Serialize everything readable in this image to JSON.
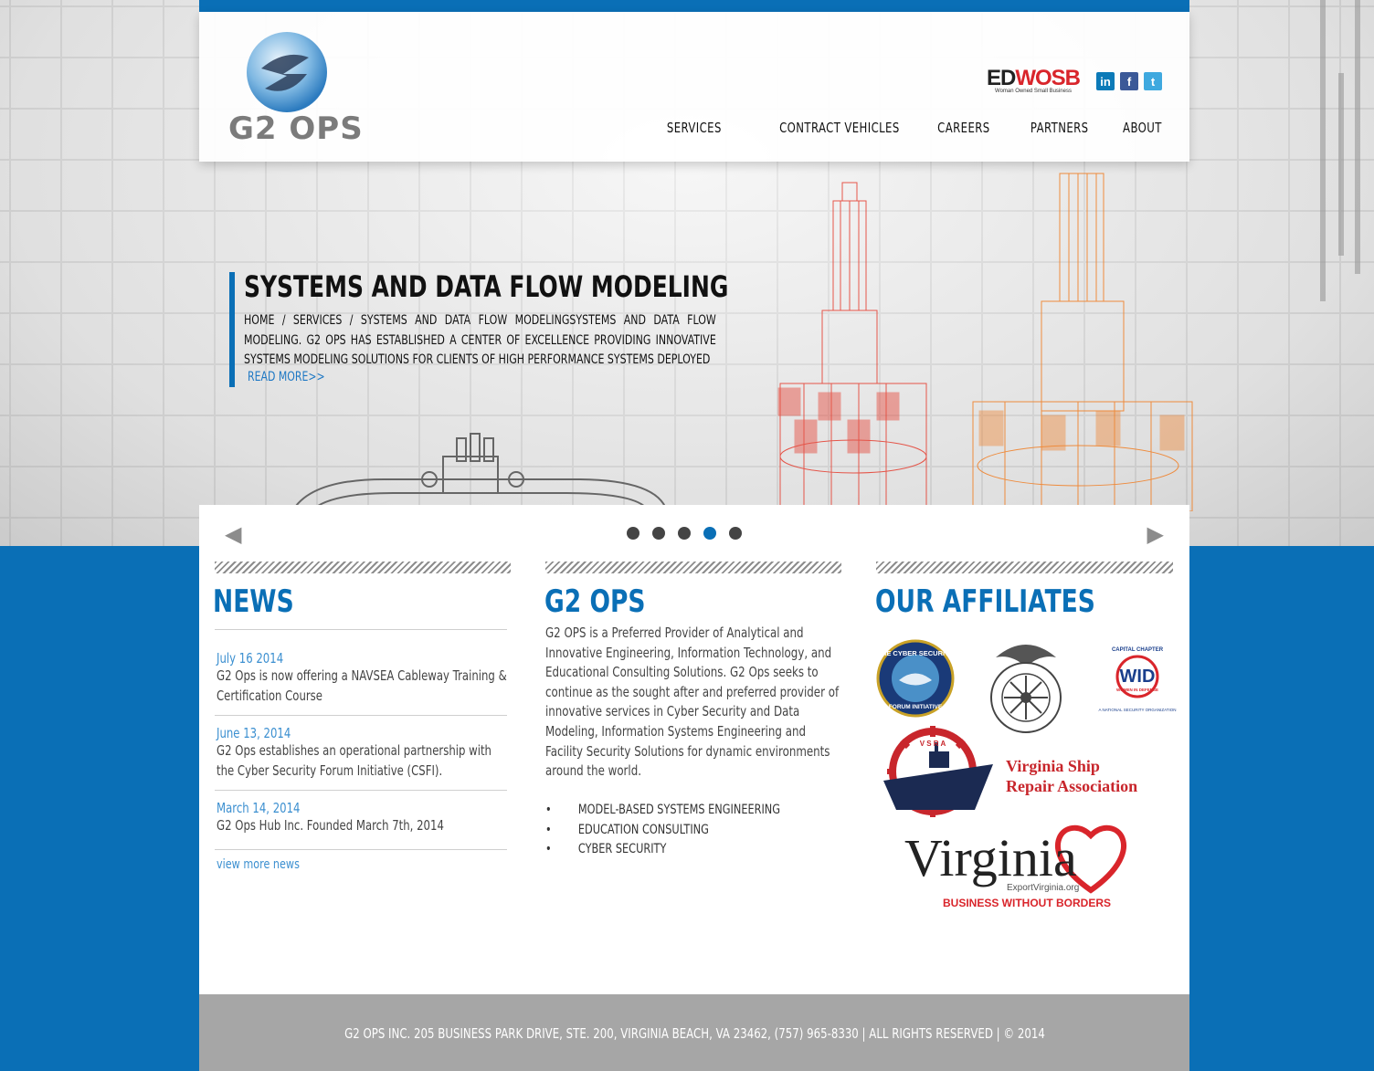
{
  "header": {
    "logo_text": "G2 OPS",
    "badge": {
      "ed": "ED",
      "wosb": "WOSB",
      "sub": "Woman Owned Small Business"
    },
    "social": [
      {
        "name": "linkedin",
        "glyph": "in"
      },
      {
        "name": "facebook",
        "glyph": "f"
      },
      {
        "name": "twitter",
        "glyph": "t"
      }
    ],
    "nav": [
      "SERVICES",
      "CONTRACT VEHICLES",
      "CAREERS",
      "PARTNERS",
      "ABOUT"
    ]
  },
  "hero": {
    "title": "SYSTEMS AND DATA FLOW MODELING",
    "body": "Home / Services / Systems and Data Flow ModelingSystems and Data Flow Modeling. G2 Ops has established a Center of Excellence providing innovative systems modeling solutions for clients of high performance systems deployed",
    "read_more": "Read More>>"
  },
  "slider": {
    "dots": 5,
    "active_index": 3
  },
  "news": {
    "title": "NEWS",
    "items": [
      {
        "date": "July 16 2014",
        "text": "G2 Ops is now offering a NAVSEA Cableway Training & Certification Course"
      },
      {
        "date": "June 13, 2014",
        "text": "G2 Ops establishes an operational partnership with the Cyber Security Forum Initiative (CSFI)."
      },
      {
        "date": "March 14, 2014",
        "text": "G2 Ops Hub Inc. Founded March 7th, 2014"
      }
    ],
    "more_link": "view more news"
  },
  "about": {
    "title": "G2 OPS",
    "text": "G2 OPS is a Preferred Provider of Analytical and Innovative Engineering, Information Technology, and Educational Consulting Solutions. G2 Ops seeks to continue as the sought after and preferred provider of innovative services in Cyber Security and Data Modeling, Information Systems Engineering and Facility Security Solutions for dynamic environments around the world.",
    "bullets": [
      "MODEL-BASED SYSTEMS ENGINEERING",
      "EDUCATION CONSULTING",
      "CYBER SECURITY"
    ]
  },
  "affiliates": {
    "title": "OUR AFFILIATES",
    "csfi": {
      "top": "THE CYBER SECURITY",
      "bottom": "FORUM INITIATIVE"
    },
    "wid": {
      "top": "CAPITAL CHAPTER",
      "letters": "WID",
      "mid": "WOMEN IN DEFENSE",
      "bottom": "A NATIONAL SECURITY ORGANIZATION"
    },
    "vsra": {
      "wheel": "V S R A",
      "line1": "Virginia Ship",
      "line2": "Repair Association"
    },
    "virginia": {
      "word": "Virginia",
      "url": "ExportVirginia.org",
      "tag": "BUSINESS WITHOUT BORDERS"
    }
  },
  "footer": {
    "text": "G2 OPS INC. 205 BUSINESS PARK DRIVE, STE. 200, VIRGINIA BEACH, VA 23462, (757) 965-8330 | ALL RIGHTS RESERVED | © 2014"
  },
  "colors": {
    "brand_blue": "#0a6fb6",
    "link_blue": "#3b8fd0",
    "footer_gray": "#a6a6a6",
    "accent_red": "#d9252b"
  }
}
